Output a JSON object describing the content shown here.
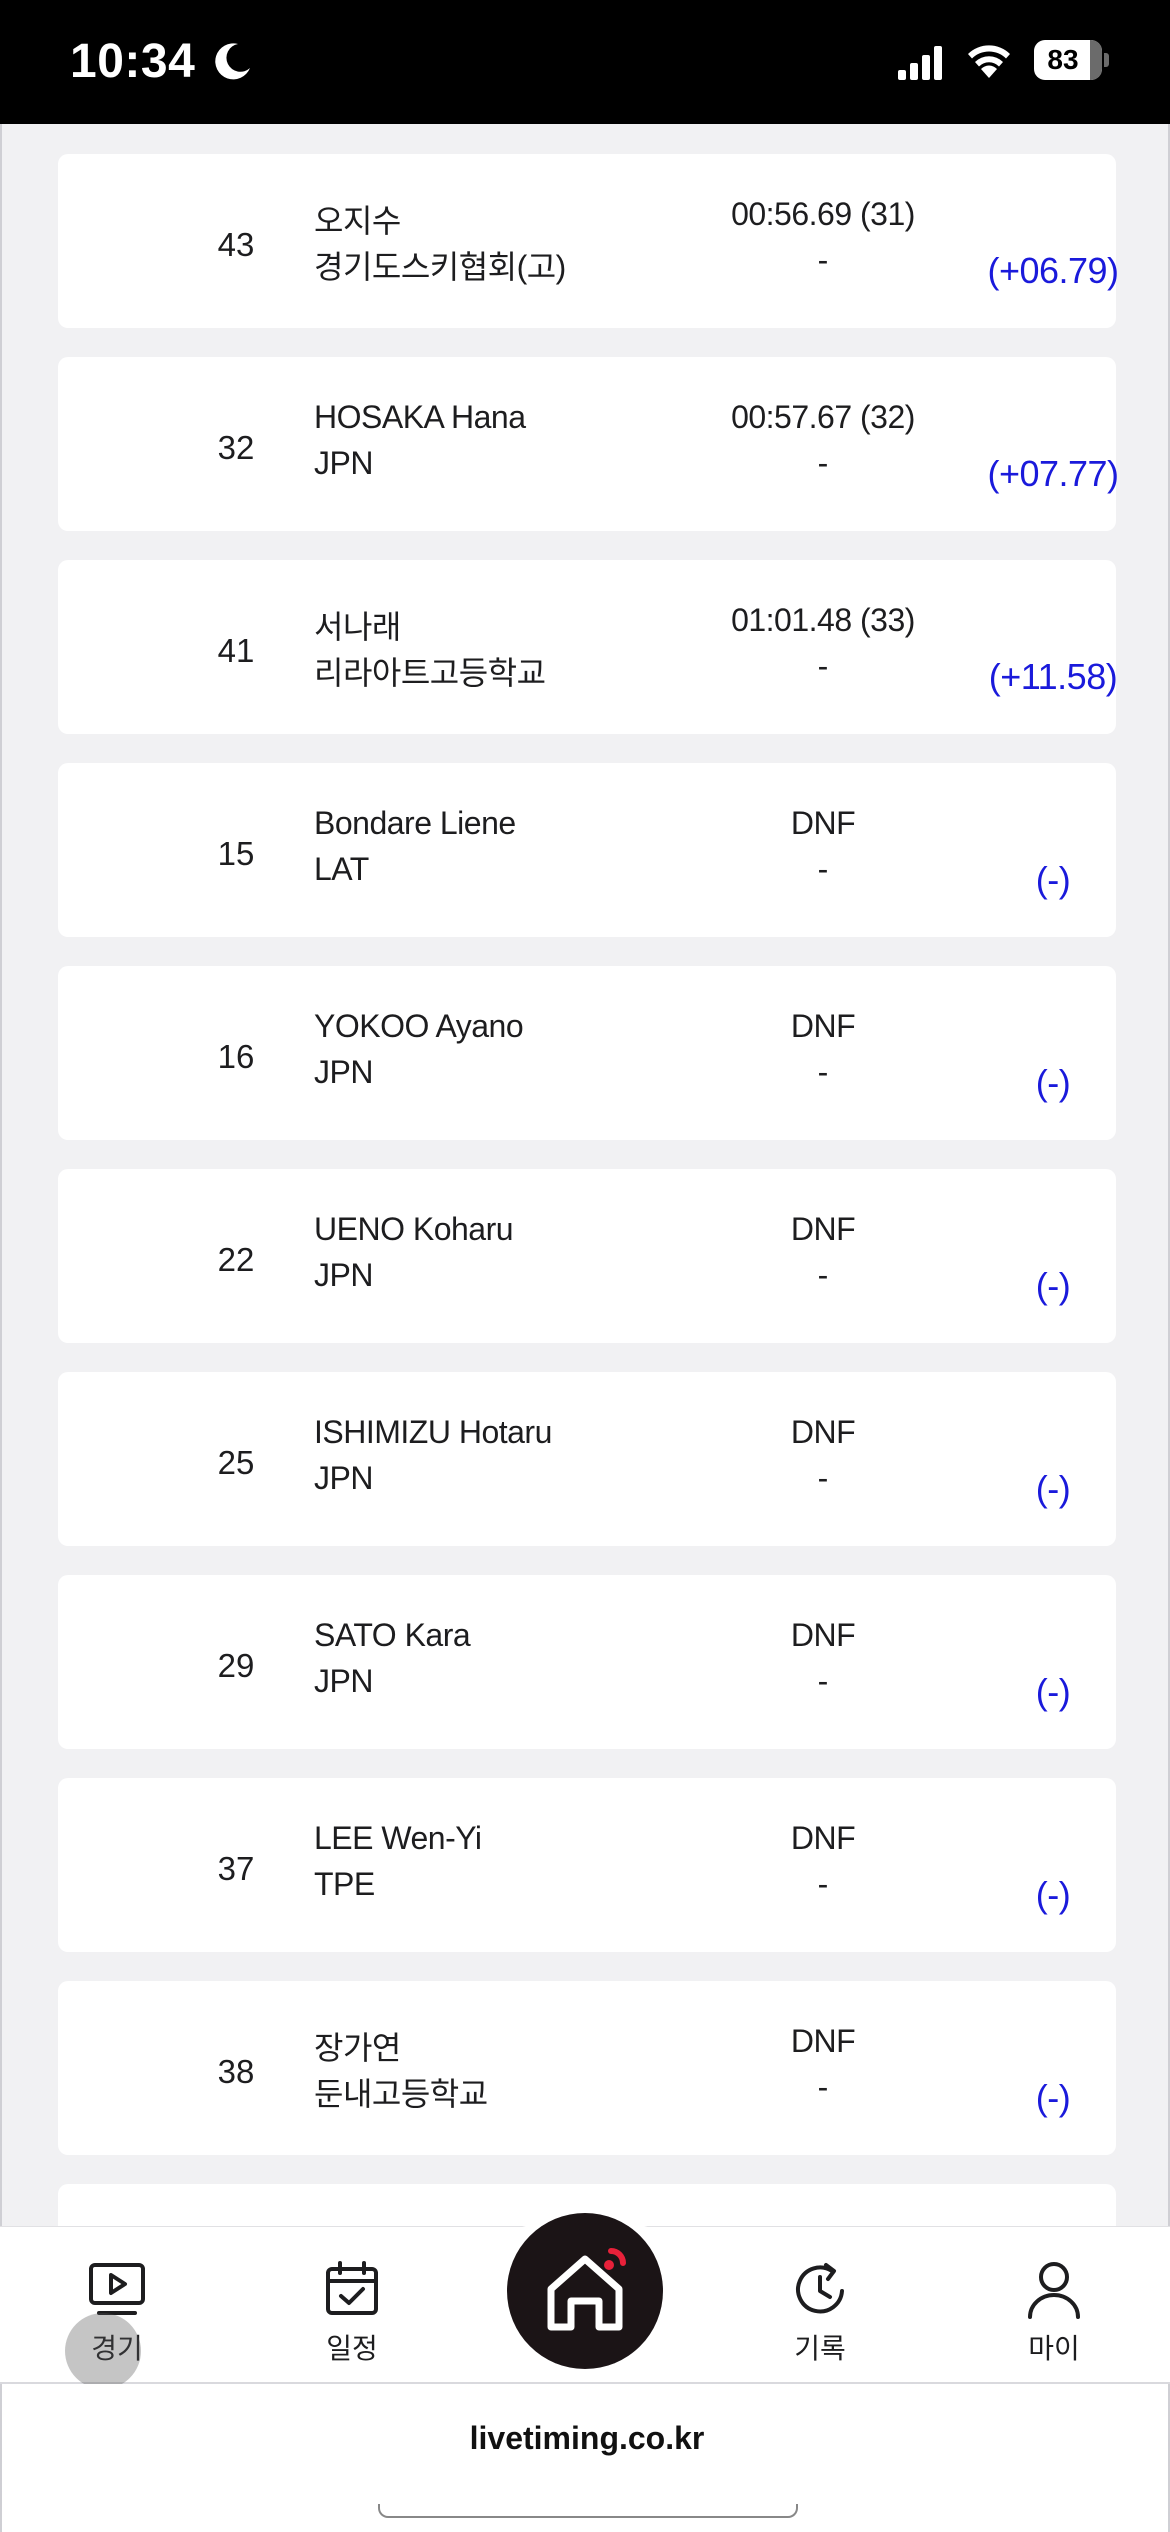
{
  "status_bar": {
    "time": "10:34",
    "battery": "83",
    "icons": [
      "moon-icon",
      "signal-icon",
      "wifi-icon",
      "battery-icon"
    ]
  },
  "results": [
    {
      "bib": "43",
      "name": "오지수",
      "team": "경기도스키협회(고)",
      "time": "00:56.69 (31)",
      "sub": "-",
      "diff": "(+06.79)"
    },
    {
      "bib": "32",
      "name": "HOSAKA Hana",
      "team": "JPN",
      "time": "00:57.67 (32)",
      "sub": "-",
      "diff": "(+07.77)"
    },
    {
      "bib": "41",
      "name": "서나래",
      "team": "리라아트고등학교",
      "time": "01:01.48 (33)",
      "sub": "-",
      "diff": "(+11.58)"
    },
    {
      "bib": "15",
      "name": "Bondare Liene",
      "team": "LAT",
      "time": "DNF",
      "sub": "-",
      "diff": "(-)"
    },
    {
      "bib": "16",
      "name": "YOKOO Ayano",
      "team": "JPN",
      "time": "DNF",
      "sub": "-",
      "diff": "(-)"
    },
    {
      "bib": "22",
      "name": "UENO Koharu",
      "team": "JPN",
      "time": "DNF",
      "sub": "-",
      "diff": "(-)"
    },
    {
      "bib": "25",
      "name": "ISHIMIZU Hotaru",
      "team": "JPN",
      "time": "DNF",
      "sub": "-",
      "diff": "(-)"
    },
    {
      "bib": "29",
      "name": "SATO Kara",
      "team": "JPN",
      "time": "DNF",
      "sub": "-",
      "diff": "(-)"
    },
    {
      "bib": "37",
      "name": "LEE Wen-Yi",
      "team": "TPE",
      "time": "DNF",
      "sub": "-",
      "diff": "(-)"
    },
    {
      "bib": "38",
      "name": "장가연",
      "team": "둔내고등학교",
      "time": "DNF",
      "sub": "-",
      "diff": "(-)"
    }
  ],
  "tab_bar": {
    "tabs": [
      {
        "label": "경기",
        "icon": "play-video-icon"
      },
      {
        "label": "일정",
        "icon": "calendar-check-icon"
      },
      {
        "label": "",
        "icon": "home-icon"
      },
      {
        "label": "기록",
        "icon": "history-clock-icon"
      },
      {
        "label": "마이",
        "icon": "user-icon"
      }
    ]
  },
  "browser": {
    "url": "livetiming.co.kr"
  },
  "colors": {
    "diff_blue": "#1a1adb",
    "home_button": "#1b1416",
    "home_accent": "#e8213a",
    "background": "#f1f1f3"
  }
}
